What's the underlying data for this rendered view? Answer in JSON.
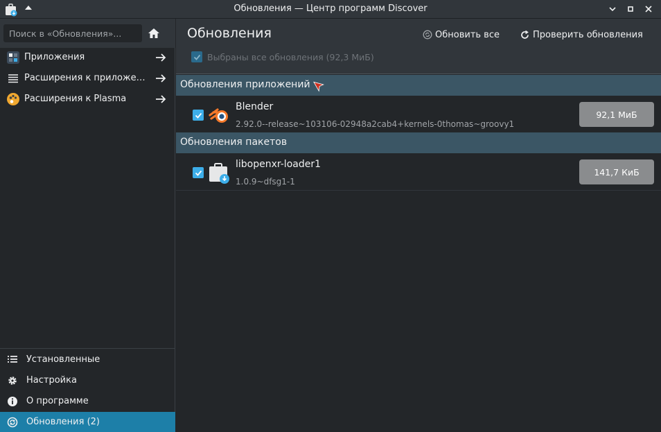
{
  "window": {
    "title": "Обновления — Центр программ Discover"
  },
  "sidebar": {
    "search_placeholder": "Поиск в «Обновления»...",
    "items": [
      {
        "label": "Приложения"
      },
      {
        "label": "Расширения к приложени..."
      },
      {
        "label": "Расширения к Plasma"
      }
    ],
    "bottom_items": [
      {
        "label": "Установленные"
      },
      {
        "label": "Настройка"
      },
      {
        "label": "О программе"
      },
      {
        "label": "Обновления (2)"
      }
    ]
  },
  "main": {
    "title": "Обновления",
    "update_all_label": "Обновить все",
    "check_updates_label": "Проверить обновления",
    "select_all_label": "Выбраны все обновления (92,3 МиБ)",
    "sections": [
      {
        "title": "Обновления приложений",
        "rows": [
          {
            "name": "Blender",
            "version": "2.92.0--release~103106-02948a2cab4+kernels-0thomas~groovy1",
            "size": "92,1 МиБ",
            "checked": true
          }
        ]
      },
      {
        "title": "Обновления пакетов",
        "rows": [
          {
            "name": "libopenxr-loader1",
            "version": "1.0.9~dfsg1-1",
            "size": "141,7 КиБ",
            "checked": true
          }
        ]
      }
    ]
  },
  "colors": {
    "accent": "#3daee9",
    "active_nav": "#1d7fa8",
    "section_header": "#3b5665"
  }
}
